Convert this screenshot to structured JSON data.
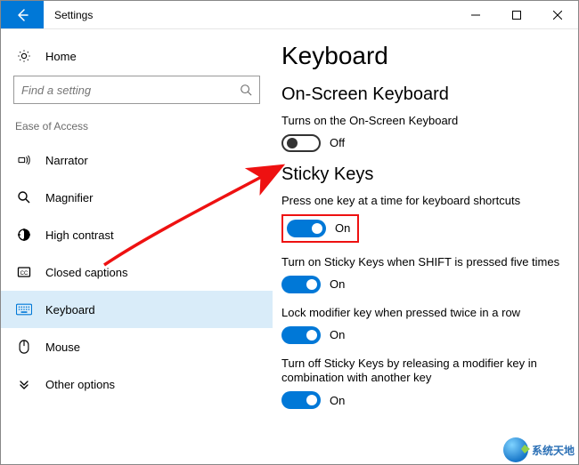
{
  "window": {
    "title": "Settings"
  },
  "sidebar": {
    "home": "Home",
    "search_placeholder": "Find a setting",
    "group": "Ease of Access",
    "items": [
      {
        "label": "Narrator"
      },
      {
        "label": "Magnifier"
      },
      {
        "label": "High contrast"
      },
      {
        "label": "Closed captions"
      },
      {
        "label": "Keyboard"
      },
      {
        "label": "Mouse"
      },
      {
        "label": "Other options"
      }
    ]
  },
  "main": {
    "title": "Keyboard",
    "sections": {
      "osk": {
        "heading": "On-Screen Keyboard",
        "desc": "Turns on the On-Screen Keyboard",
        "state": "Off"
      },
      "sticky": {
        "heading": "Sticky Keys",
        "items": [
          {
            "desc": "Press one key at a time for keyboard shortcuts",
            "state": "On"
          },
          {
            "desc": "Turn on Sticky Keys when SHIFT is pressed five times",
            "state": "On"
          },
          {
            "desc": "Lock modifier key when pressed twice in a row",
            "state": "On"
          },
          {
            "desc": "Turn off Sticky Keys by releasing a modifier key in combination with another key",
            "state": "On"
          }
        ]
      }
    }
  },
  "watermark": "系统天地"
}
